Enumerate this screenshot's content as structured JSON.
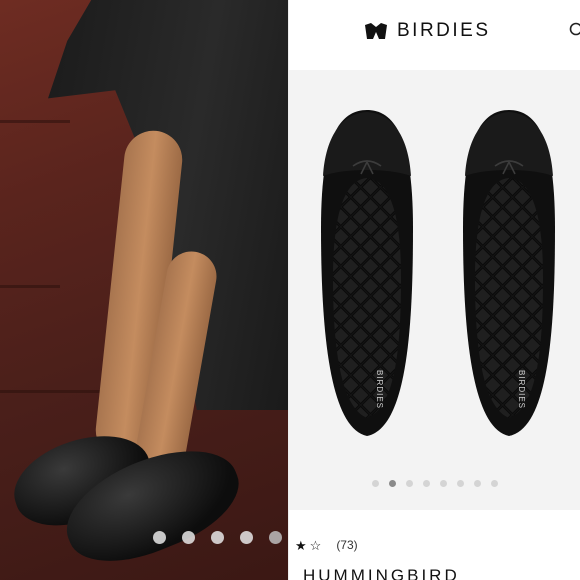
{
  "left_photo": {
    "carousel_dots": 5
  },
  "header": {
    "brand": "BIRDIES",
    "logo_icon": "birdies-logo-icon",
    "search_icon": "search-icon"
  },
  "product_image": {
    "insole_brand": "BIRDIES",
    "carousel_dots": 8,
    "active_dot": 1
  },
  "rating": {
    "stars": [
      "★",
      "☆"
    ],
    "count": "(73)"
  },
  "product": {
    "name": "HUMMINGBIRD"
  },
  "colors": {
    "photo_background": "#5a241d",
    "shoe": "#111111",
    "stage": "#f3f3f3",
    "active_dot": "#8a8a8a"
  }
}
